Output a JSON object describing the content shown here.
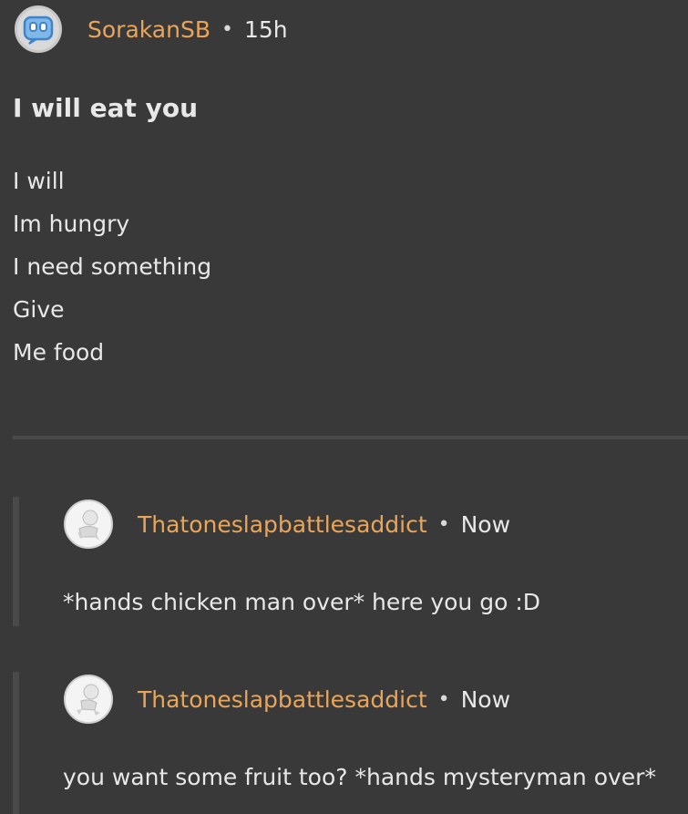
{
  "post": {
    "username": "SorakanSB",
    "separator": "•",
    "time": "15h",
    "title": "I will eat you",
    "lines": [
      "I will",
      "Im hungry",
      "I need something",
      "Give",
      "Me food"
    ]
  },
  "comments": [
    {
      "username": "Thatoneslapbattlesaddict",
      "separator": "•",
      "time": "Now",
      "text": "*hands chicken man over* here you go :D"
    },
    {
      "username": "Thatoneslapbattlesaddict",
      "separator": "•",
      "time": "Now",
      "text": "you want some fruit too? *hands mysteryman over*"
    }
  ],
  "colors": {
    "background": "#393939",
    "username": "#e9a55a",
    "text": "#e8e8e8"
  }
}
